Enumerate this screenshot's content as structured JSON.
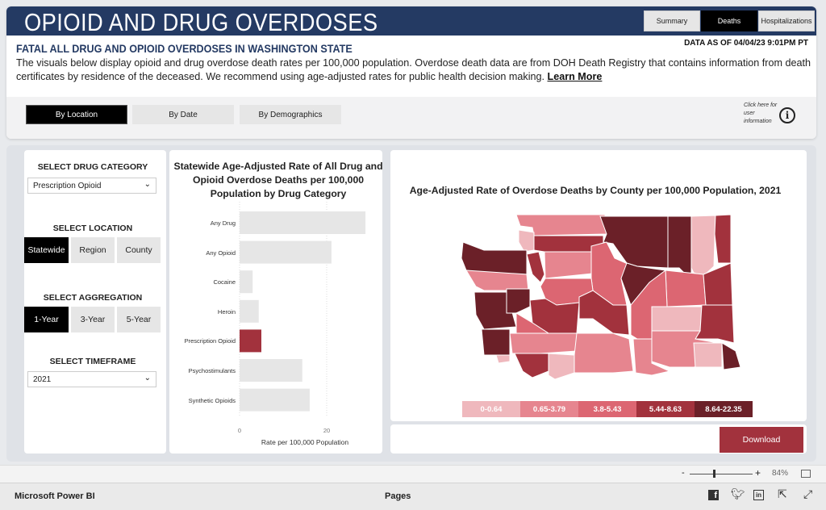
{
  "header": {
    "title": "OPIOID AND DRUG OVERDOSES",
    "nav": [
      "Summary",
      "Deaths",
      "Hospitalizations"
    ],
    "active_nav": "Deaths"
  },
  "intro": {
    "subtitle": "FATAL ALL DRUG AND OPIOID OVERDOSES IN WASHINGTON STATE",
    "data_as_of": "DATA AS OF 04/04/23 9:01PM PT",
    "description": "The visuals below display opioid and drug overdose death rates per 100,000 population. Overdose death data are from DOH Death Registry that contains information from death certificates by residence of the deceased. We recommend using age-adjusted rates for public health decision making.",
    "learn_more": "Learn More"
  },
  "tabs": [
    "By Location",
    "By Date",
    "By Demographics"
  ],
  "active_tab": "By Location",
  "info": {
    "text": "Click here for user information",
    "icon": "info-circle-icon"
  },
  "filters": {
    "drug_label": "SELECT DRUG CATEGORY",
    "drug_value": "Prescription Opioid",
    "location_label": "SELECT LOCATION",
    "locations": [
      "Statewide",
      "Region",
      "County"
    ],
    "location_selected": "Statewide",
    "aggregation_label": "SELECT AGGREGATION",
    "aggregations": [
      "1-Year",
      "3-Year",
      "5-Year"
    ],
    "aggregation_selected": "1-Year",
    "timeframe_label": "SELECT TIMEFRAME",
    "timeframe_value": "2021"
  },
  "chart_data": [
    {
      "type": "bar",
      "orientation": "horizontal",
      "title": "Statewide Age-Adjusted Rate of All Drug and Opioid Overdose Deaths per 100,000 Population by Drug Category",
      "categories": [
        "Any Drug",
        "Any Opioid",
        "Cocaine",
        "Heroin",
        "Prescription Opioid",
        "Psychostimulants",
        "Synthetic Opioids"
      ],
      "values": [
        28.9,
        21.1,
        3.0,
        4.4,
        5.0,
        14.4,
        16.1
      ],
      "highlighted": "Prescription Opioid",
      "xlabel": "Rate per 100,000 Population",
      "xticks": [
        "0",
        "20"
      ],
      "xlim": [
        0,
        30
      ],
      "colors": {
        "bar": "#e6e6e6",
        "highlight": "#a2323d"
      }
    },
    {
      "type": "choropleth",
      "title": "Age-Adjusted Rate of  Overdose Deaths by County per 100,000 Population, 2021",
      "legend": [
        {
          "label": "0-0.64",
          "color": "#efb8bd"
        },
        {
          "label": "0.65-3.79",
          "color": "#e6858f"
        },
        {
          "label": "3.8-5.43",
          "color": "#dc6672"
        },
        {
          "label": "5.44-8.63",
          "color": "#a2323d"
        },
        {
          "label": "8.64-22.35",
          "color": "#6b2028"
        }
      ]
    }
  ],
  "download": "Download",
  "zoom": {
    "minus": "-",
    "plus": "+",
    "level": "84%"
  },
  "footer": {
    "brand": "Microsoft Power BI",
    "pages": "Pages"
  }
}
